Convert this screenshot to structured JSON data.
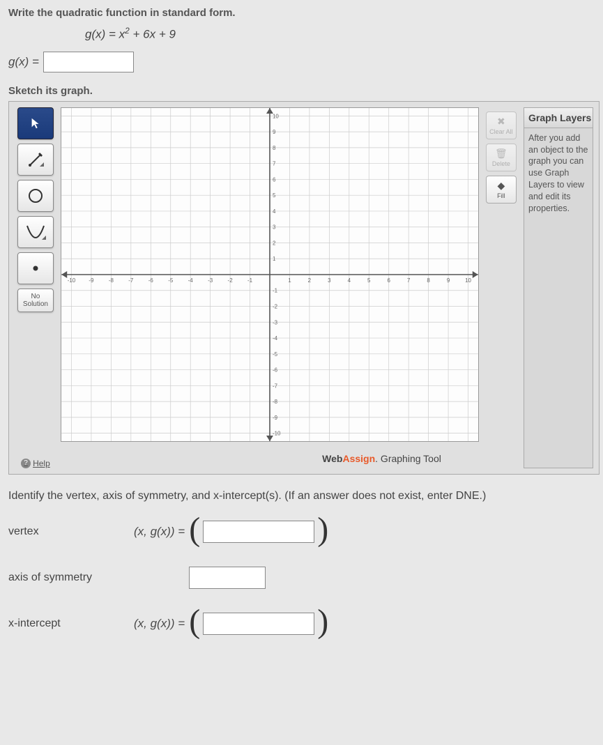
{
  "prompt": "Write the quadratic function in standard form.",
  "equation": {
    "lhs": "g(x)",
    "rhs_prefix": "x",
    "rhs_exp": "2",
    "rhs_suffix": " + 6x + 9"
  },
  "answer": {
    "lhs": "g(x) ="
  },
  "sketch_prompt": "Sketch its graph.",
  "toolbar": {
    "no_solution_line1": "No",
    "no_solution_line2": "Solution",
    "help": "Help"
  },
  "side_tools": {
    "clear": "Clear All",
    "delete": "Delete",
    "fill": "Fill"
  },
  "layers": {
    "title": "Graph Layers",
    "body": "After you add an object to the graph you can use Graph Layers to view and edit its properties."
  },
  "brand": {
    "web": "Web",
    "assign": "Assign",
    "suffix": ". Graphing Tool"
  },
  "chart_data": {
    "type": "scatter",
    "series": [],
    "x_ticks": [
      -10,
      -9,
      -8,
      -7,
      -6,
      -5,
      -4,
      -3,
      -2,
      -1,
      1,
      2,
      3,
      4,
      5,
      6,
      7,
      8,
      9,
      10
    ],
    "y_ticks": [
      -10,
      -9,
      -8,
      -7,
      -6,
      -5,
      -4,
      -3,
      -2,
      -1,
      1,
      2,
      3,
      4,
      5,
      6,
      7,
      8,
      9,
      10
    ],
    "xlim": [
      -10.5,
      10.5
    ],
    "ylim": [
      -10.5,
      10.5
    ],
    "xlabel": "",
    "ylabel": "",
    "title": "",
    "grid": true
  },
  "identify": {
    "prompt": "Identify the vertex, axis of symmetry, and x-intercept(s). (If an answer does not exist, enter DNE.)",
    "vertex_label": "vertex",
    "vertex_expr": "(x, g(x))  =",
    "axis_label": "axis of symmetry",
    "xint_label": "x-intercept",
    "xint_expr": "(x, g(x))  ="
  }
}
